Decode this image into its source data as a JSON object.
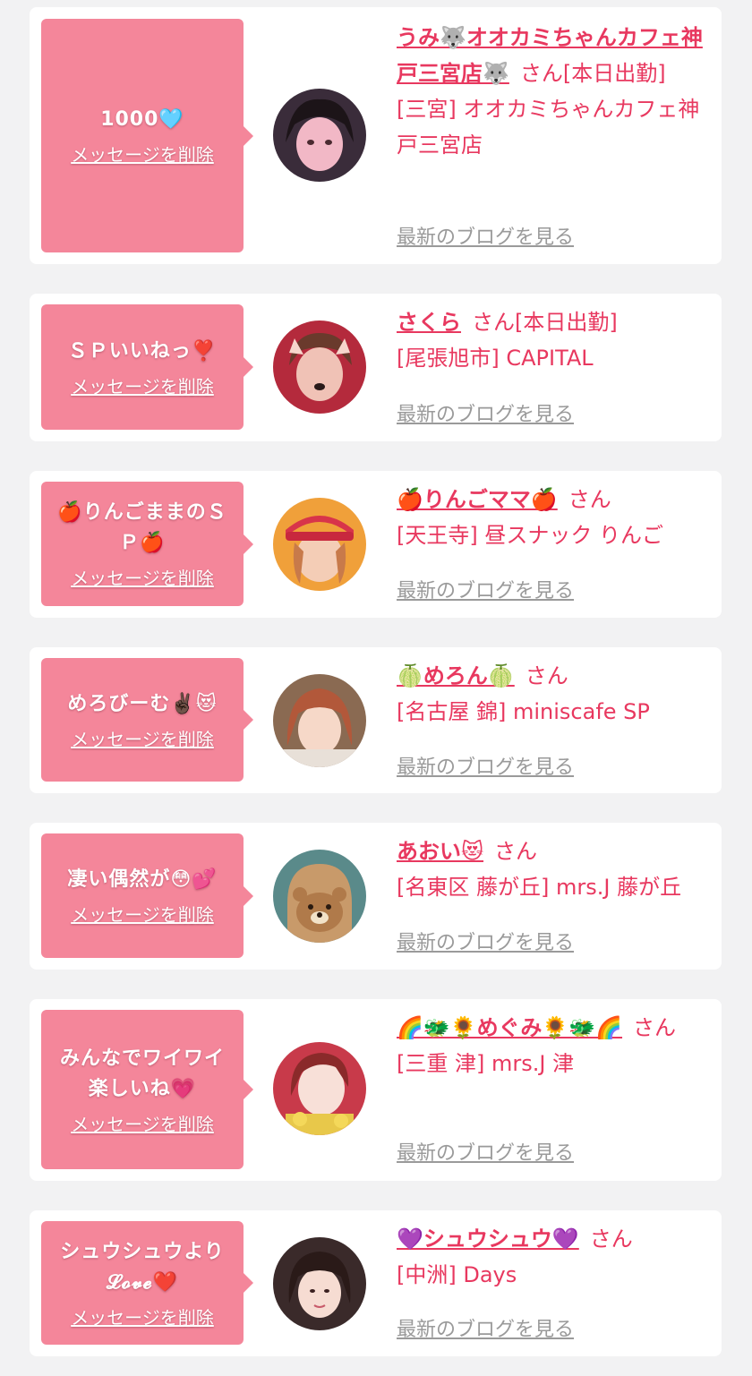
{
  "delete_label": "メッセージを削除",
  "blog_label": "最新のブログを見る",
  "san_label": "さん",
  "colors": {
    "accent": "#e8385f",
    "bubble": "#f4869a",
    "link_gray": "#9a9a9a",
    "background": "#f2f2f3"
  },
  "items": [
    {
      "message": "1000🩵",
      "name": "うみ🐺オオカミちゃんカフェ神戸三宮店🐺",
      "status": "[本日出勤]",
      "shop": "[三宮] オオカミちゃんカフェ神戸三宮店"
    },
    {
      "message": "ＳＰいいねっ❣️",
      "name": "さくら",
      "status": "[本日出勤]",
      "shop": "[尾張旭市] CAPITAL"
    },
    {
      "message": "🍎りんごままのＳＰ🍎",
      "name": "🍎りんごママ🍎",
      "status": "",
      "shop": "[天王寺] 昼スナック りんご"
    },
    {
      "message": "めろびーむ✌🏿😻",
      "name": "🍈めろん🍈",
      "status": "",
      "shop": "[名古屋 錦] miniscafe SP"
    },
    {
      "message": "凄い偶然が😳💕",
      "name": "あおい😻",
      "status": "",
      "shop": "[名東区 藤が丘] mrs.J 藤が丘"
    },
    {
      "message": "みんなでワイワイ楽しいね💗",
      "name": "🌈🐲🌻めぐみ🌻🐲🌈",
      "status": "",
      "shop": "[三重 津] mrs.J 津"
    },
    {
      "message": "シュウシュウより𝓛𝓸𝓿𝓮❤️",
      "name": "💜シュウシュウ💜",
      "status": "",
      "shop": "[中洲] Days"
    }
  ]
}
